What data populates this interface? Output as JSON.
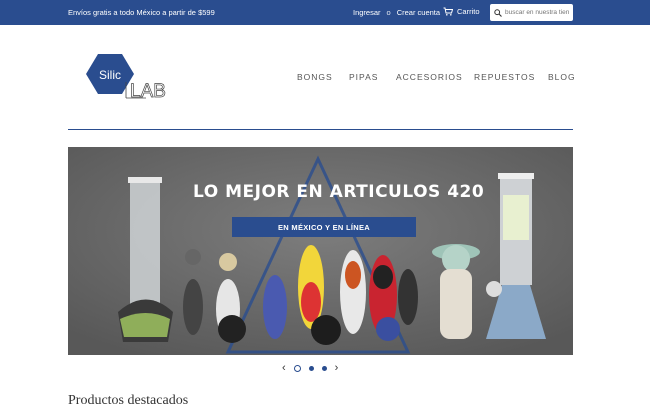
{
  "topbar": {
    "promo": "Envíos gratis a todo México a partir de $599",
    "login": "Ingresar",
    "or": "o",
    "register": "Crear cuenta",
    "cart": "Carrito",
    "search_placeholder": "buscar en nuestra tienda"
  },
  "logo": {
    "text_a": "Silic",
    "text_b": "LAB"
  },
  "nav": [
    "BONGS",
    "PIPAS",
    "ACCESORIOS",
    "REPUESTOS",
    "BLOG"
  ],
  "hero": {
    "headline": "LO MEJOR EN ARTICULOS 420",
    "tagline": "EN MÉXICO Y EN LÍNEA"
  },
  "slider": {
    "prev": "‹",
    "next": "›",
    "slides": 3,
    "active": 1
  },
  "section": {
    "title": "Productos destacados"
  },
  "colors": {
    "brand": "#2a4d8f"
  }
}
